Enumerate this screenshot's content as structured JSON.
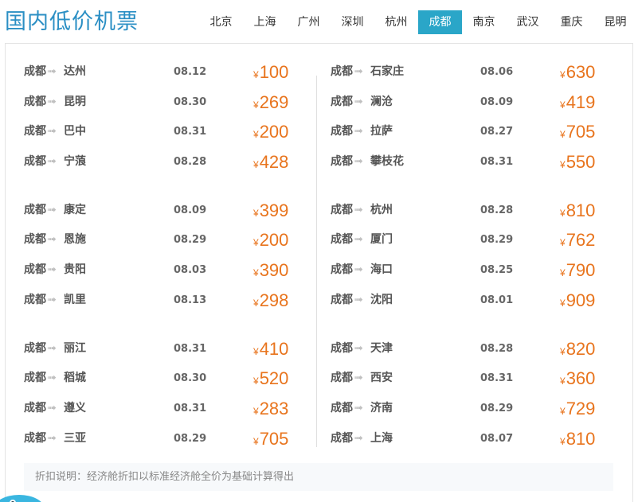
{
  "header": {
    "title": "国内低价机票",
    "tabs": [
      "北京",
      "上海",
      "广州",
      "深圳",
      "杭州",
      "成都",
      "南京",
      "武汉",
      "重庆",
      "昆明"
    ],
    "active_tab": "成都"
  },
  "currency_symbol": "¥",
  "route_arrow": "➟",
  "left_groups": [
    [
      {
        "from": "成都",
        "to": "达州",
        "date": "08.12",
        "price": "100"
      },
      {
        "from": "成都",
        "to": "昆明",
        "date": "08.30",
        "price": "269"
      },
      {
        "from": "成都",
        "to": "巴中",
        "date": "08.31",
        "price": "200"
      },
      {
        "from": "成都",
        "to": "宁蒗",
        "date": "08.28",
        "price": "428"
      }
    ],
    [
      {
        "from": "成都",
        "to": "康定",
        "date": "08.09",
        "price": "399"
      },
      {
        "from": "成都",
        "to": "恩施",
        "date": "08.29",
        "price": "200"
      },
      {
        "from": "成都",
        "to": "贵阳",
        "date": "08.03",
        "price": "390"
      },
      {
        "from": "成都",
        "to": "凯里",
        "date": "08.13",
        "price": "298"
      }
    ],
    [
      {
        "from": "成都",
        "to": "丽江",
        "date": "08.31",
        "price": "410"
      },
      {
        "from": "成都",
        "to": "稻城",
        "date": "08.30",
        "price": "520"
      },
      {
        "from": "成都",
        "to": "遵义",
        "date": "08.31",
        "price": "283"
      },
      {
        "from": "成都",
        "to": "三亚",
        "date": "08.29",
        "price": "705"
      }
    ]
  ],
  "right_groups": [
    [
      {
        "from": "成都",
        "to": "石家庄",
        "date": "08.06",
        "price": "630"
      },
      {
        "from": "成都",
        "to": "澜沧",
        "date": "08.09",
        "price": "419"
      },
      {
        "from": "成都",
        "to": "拉萨",
        "date": "08.27",
        "price": "705"
      },
      {
        "from": "成都",
        "to": "攀枝花",
        "date": "08.31",
        "price": "550"
      }
    ],
    [
      {
        "from": "成都",
        "to": "杭州",
        "date": "08.28",
        "price": "810"
      },
      {
        "from": "成都",
        "to": "厦门",
        "date": "08.29",
        "price": "762"
      },
      {
        "from": "成都",
        "to": "海口",
        "date": "08.25",
        "price": "790"
      },
      {
        "from": "成都",
        "to": "沈阳",
        "date": "08.01",
        "price": "909"
      }
    ],
    [
      {
        "from": "成都",
        "to": "天津",
        "date": "08.28",
        "price": "820"
      },
      {
        "from": "成都",
        "to": "西安",
        "date": "08.31",
        "price": "360"
      },
      {
        "from": "成都",
        "to": "济南",
        "date": "08.29",
        "price": "729"
      },
      {
        "from": "成都",
        "to": "上海",
        "date": "08.07",
        "price": "810"
      }
    ]
  ],
  "footer_note": "折扣说明：经济舱折扣以标准经济舱全价为基础计算得出",
  "colors": {
    "title": "#2b8fc4",
    "active_tab_bg": "#2aa6c8",
    "price": "#e8741d"
  }
}
